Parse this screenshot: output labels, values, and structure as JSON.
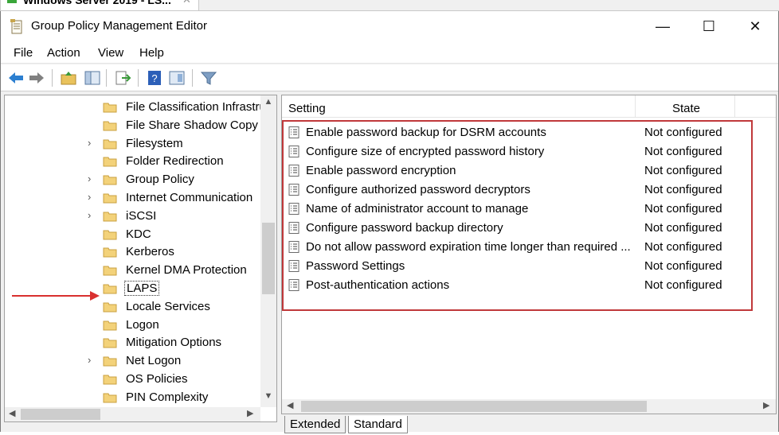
{
  "outer_tab": {
    "title": "Windows Server 2019 - LS...",
    "close": "✕"
  },
  "window": {
    "title": "Group Policy Management Editor",
    "minimize": "—",
    "maximize": "☐",
    "close": "✕"
  },
  "menu": [
    "File",
    "Action",
    "View",
    "Help"
  ],
  "toolbar": {
    "buttons": [
      "back-icon",
      "forward-icon",
      "up-folder-icon",
      "show-hide-tree-icon",
      "export-list-icon",
      "help-icon",
      "properties-pane-icon",
      "filter-icon"
    ]
  },
  "tree": {
    "items": [
      {
        "label": "File Classification Infrastru",
        "expandable": false
      },
      {
        "label": "File Share Shadow Copy P",
        "expandable": false
      },
      {
        "label": "Filesystem",
        "expandable": true
      },
      {
        "label": "Folder Redirection",
        "expandable": false
      },
      {
        "label": "Group Policy",
        "expandable": true
      },
      {
        "label": "Internet Communication",
        "expandable": true
      },
      {
        "label": "iSCSI",
        "expandable": true
      },
      {
        "label": "KDC",
        "expandable": false
      },
      {
        "label": "Kerberos",
        "expandable": false
      },
      {
        "label": "Kernel DMA Protection",
        "expandable": false
      },
      {
        "label": "LAPS",
        "expandable": false,
        "selected": true
      },
      {
        "label": "Locale Services",
        "expandable": false
      },
      {
        "label": "Logon",
        "expandable": false
      },
      {
        "label": "Mitigation Options",
        "expandable": false
      },
      {
        "label": "Net Logon",
        "expandable": true
      },
      {
        "label": "OS Policies",
        "expandable": false
      },
      {
        "label": "PIN Complexity",
        "expandable": false
      }
    ]
  },
  "list": {
    "columns": {
      "setting": "Setting",
      "state": "State"
    },
    "rows": [
      {
        "setting": "Enable password backup for DSRM accounts",
        "state": "Not configured"
      },
      {
        "setting": "Configure size of encrypted password history",
        "state": "Not configured"
      },
      {
        "setting": "Enable password encryption",
        "state": "Not configured"
      },
      {
        "setting": "Configure authorized password decryptors",
        "state": "Not configured"
      },
      {
        "setting": "Name of administrator account to manage",
        "state": "Not configured"
      },
      {
        "setting": "Configure password backup directory",
        "state": "Not configured"
      },
      {
        "setting": "Do not allow password expiration time longer than required ...",
        "state": "Not configured"
      },
      {
        "setting": "Password Settings",
        "state": "Not configured"
      },
      {
        "setting": "Post-authentication actions",
        "state": "Not configured"
      }
    ]
  },
  "bottom_tabs": [
    "Extended",
    "Standard"
  ],
  "colors": {
    "annotation_red": "#c0393b",
    "folder_yellow": "#f3d27a"
  }
}
